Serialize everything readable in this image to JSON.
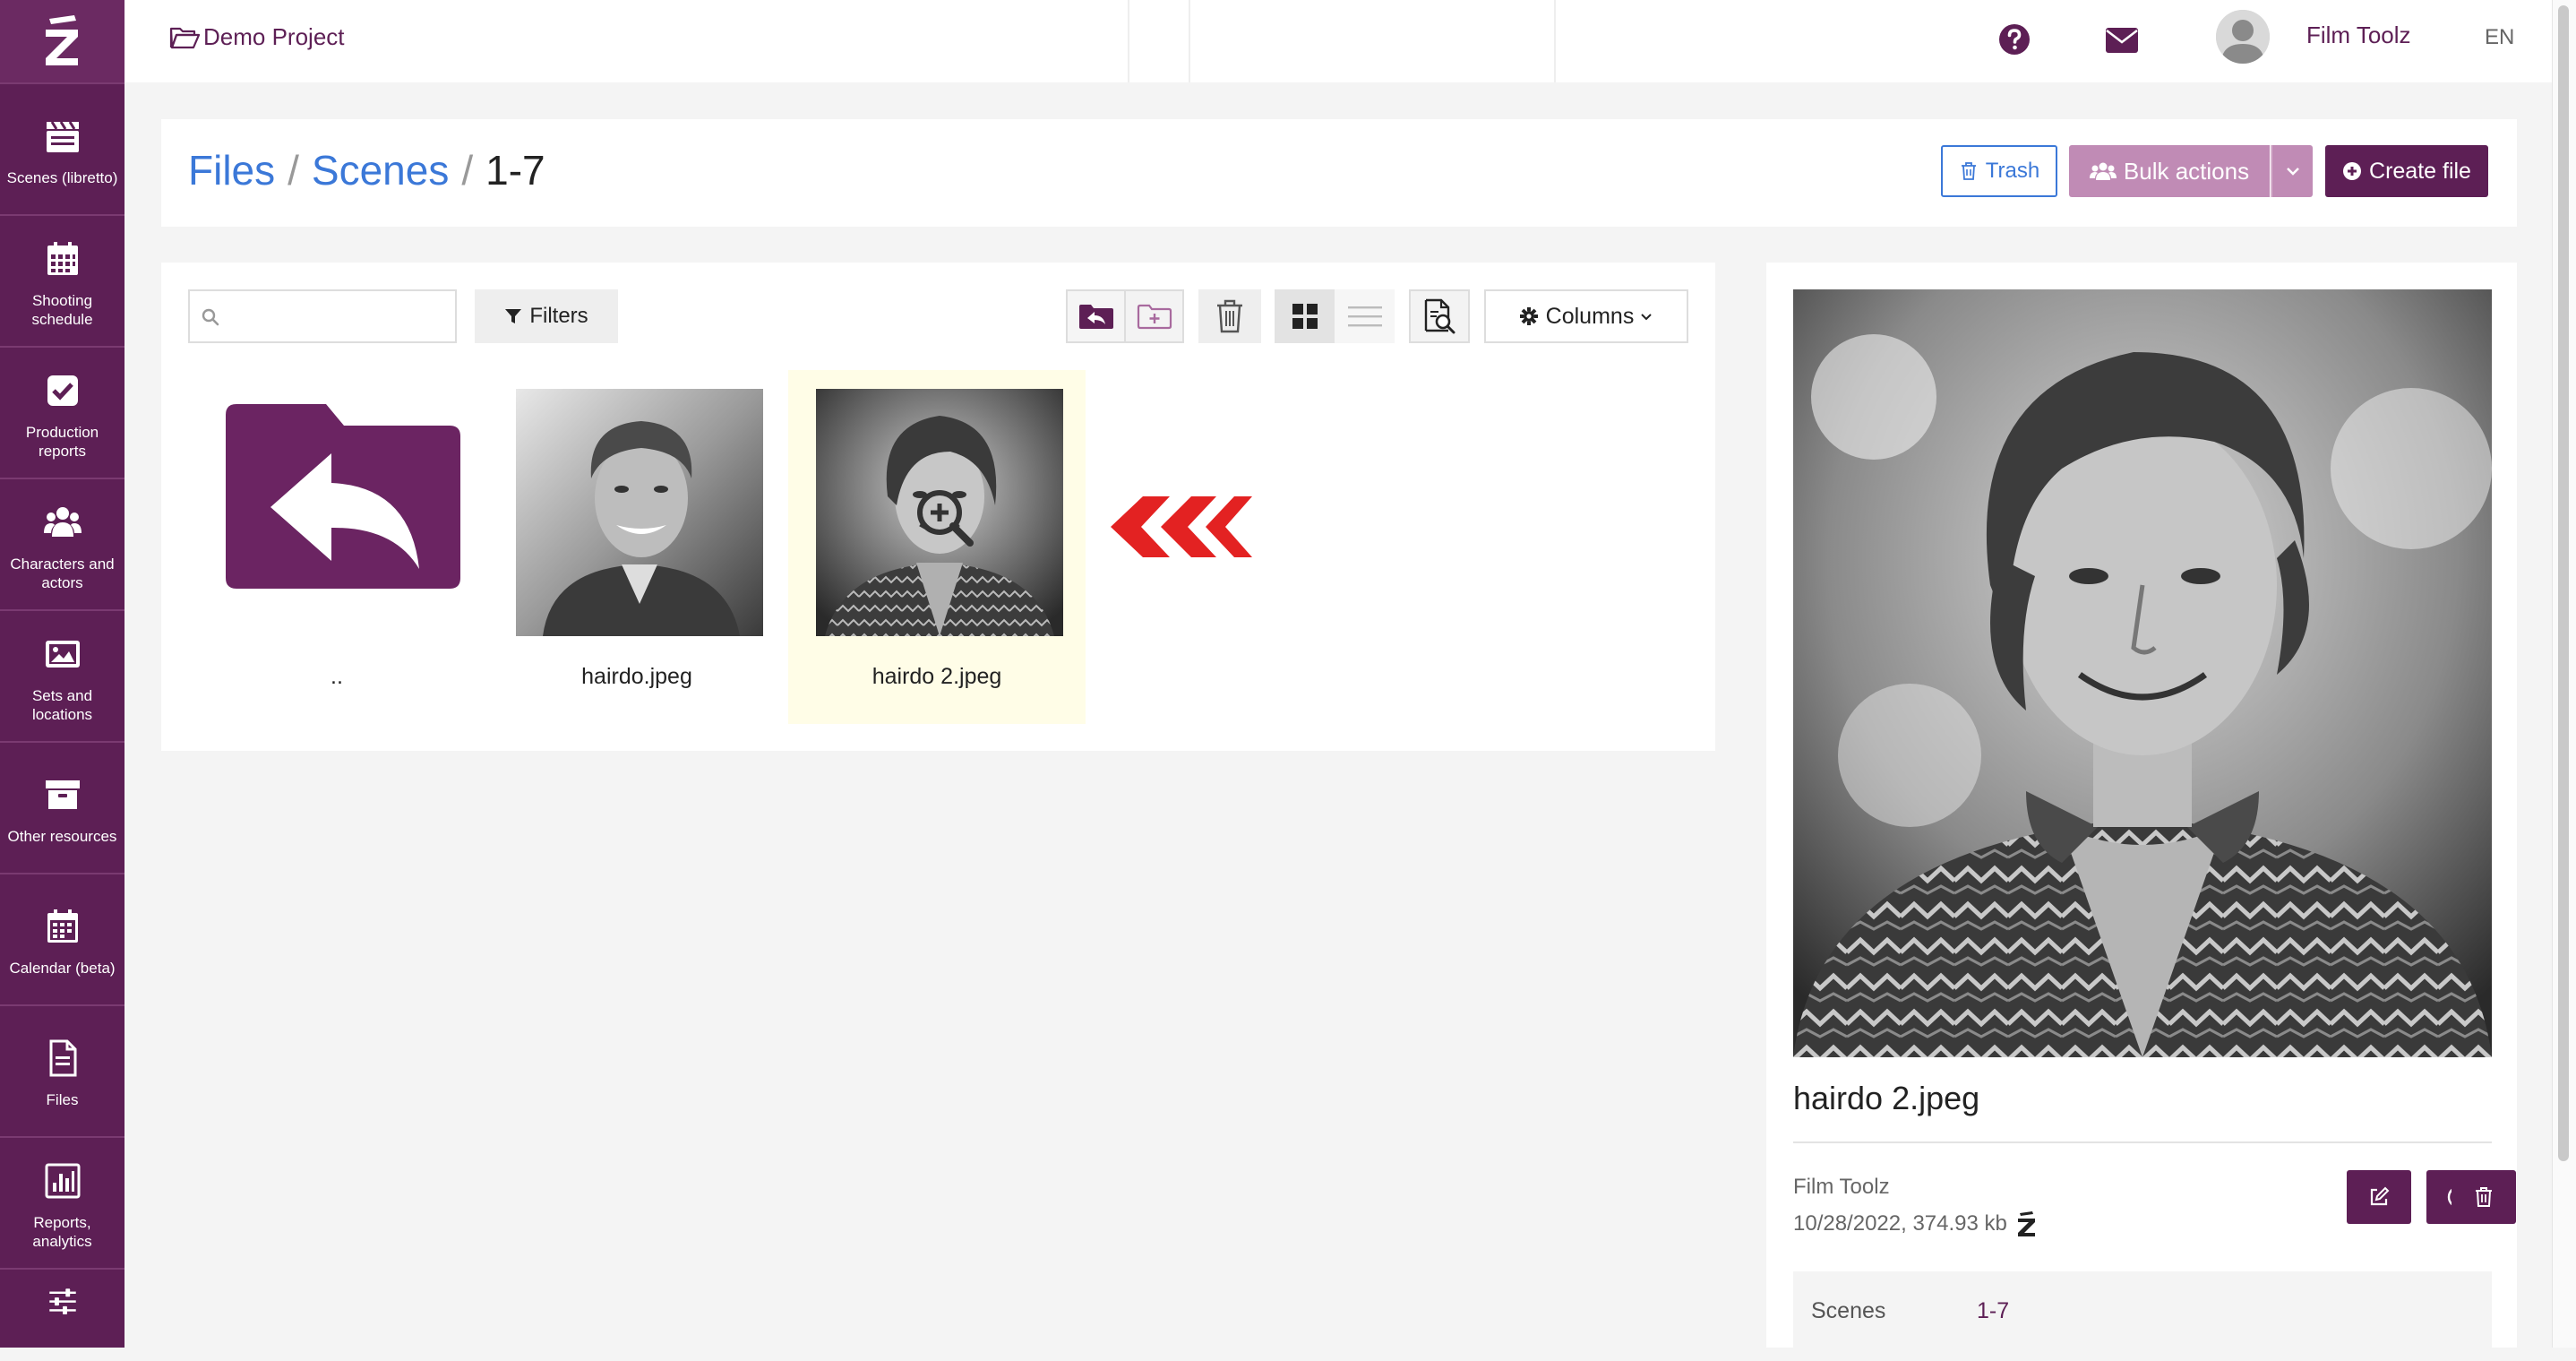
{
  "sidebar": {
    "logo_glyph": "Z",
    "items": [
      {
        "label": "Scenes (libretto)",
        "icon": "clapperboard-icon"
      },
      {
        "label": "Shooting schedule",
        "icon": "calendar-grid-icon"
      },
      {
        "label": "Production reports",
        "icon": "checkbox-icon"
      },
      {
        "label": "Characters and actors",
        "icon": "users-icon"
      },
      {
        "label": "Sets and locations",
        "icon": "image-icon"
      },
      {
        "label": "Other resources",
        "icon": "archive-icon"
      },
      {
        "label": "Calendar (beta)",
        "icon": "calendar-icon"
      },
      {
        "label": "Files",
        "icon": "file-icon"
      },
      {
        "label": "Reports, analytics",
        "icon": "bar-chart-icon"
      },
      {
        "label": "",
        "icon": "sliders-icon"
      }
    ]
  },
  "topbar": {
    "project": "Demo Project",
    "user_name": "Film Toolz",
    "language": "EN"
  },
  "breadcrumb": {
    "files": "Files",
    "scenes": "Scenes",
    "current": "1-7",
    "separator": "/"
  },
  "actions": {
    "trash": "Trash",
    "bulk": "Bulk actions",
    "create": "Create file"
  },
  "toolbar": {
    "search_placeholder": "",
    "filters": "Filters",
    "columns": "Columns"
  },
  "files": [
    {
      "name": "..",
      "type": "parent-folder"
    },
    {
      "name": "hairdo.jpeg",
      "type": "image"
    },
    {
      "name": "hairdo 2.jpeg",
      "type": "image",
      "selected": true
    }
  ],
  "detail": {
    "name": "hairdo 2.jpeg",
    "owner": "Film Toolz",
    "meta": "10/28/2022, 374.93 kb",
    "scenes_label": "Scenes",
    "scenes_value": "1-7"
  },
  "colors": {
    "brand": "#5d1f55",
    "brand_light": "#c08bb5",
    "link": "#3b78d8",
    "selected_bg": "#fffde7",
    "arrow_red": "#e32222"
  }
}
